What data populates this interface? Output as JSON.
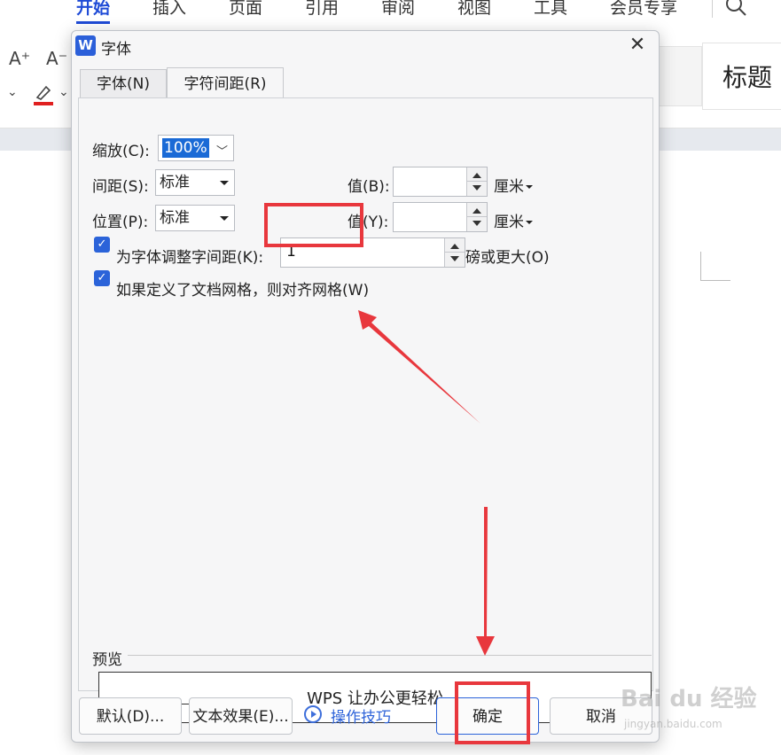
{
  "ribbon": {
    "tabs": [
      "开始",
      "插入",
      "页面",
      "引用",
      "审阅",
      "视图",
      "工具",
      "会员专享"
    ],
    "active_tab": "开始",
    "increase_font": "A⁺",
    "decrease_font": "A⁻",
    "style_heading": "标题"
  },
  "dialog": {
    "title": "字体",
    "app_icon": "W",
    "tabs": [
      {
        "label": "字体(N)",
        "active": false
      },
      {
        "label": "字符间距(R)",
        "active": true
      }
    ],
    "scale": {
      "label": "缩放(C):",
      "value": "100%"
    },
    "spacing": {
      "label": "间距(S):",
      "value": "标准",
      "value_label": "值(B):",
      "amount": "",
      "unit": "厘米"
    },
    "position": {
      "label": "位置(P):",
      "value": "标准",
      "value_label": "值(Y):",
      "amount": "",
      "unit": "厘米"
    },
    "kerning": {
      "checked": true,
      "label": "为字体调整字间距(K):",
      "value": "1",
      "suffix": "磅或更大(O)"
    },
    "snap_grid": {
      "checked": true,
      "label": "如果定义了文档网格，则对齐网格(W)"
    },
    "preview": {
      "label": "预览",
      "text": "WPS 让办公更轻松"
    },
    "buttons": {
      "default": "默认(D)...",
      "text_effects": "文本效果(E)...",
      "tips": "操作技巧",
      "ok": "确定",
      "cancel": "取消"
    }
  },
  "watermark": {
    "text": "Bai du 经验",
    "sub": "jingyan.baidu.com"
  },
  "colors": {
    "accent": "#2b63d9",
    "annotation": "#e8373d"
  }
}
